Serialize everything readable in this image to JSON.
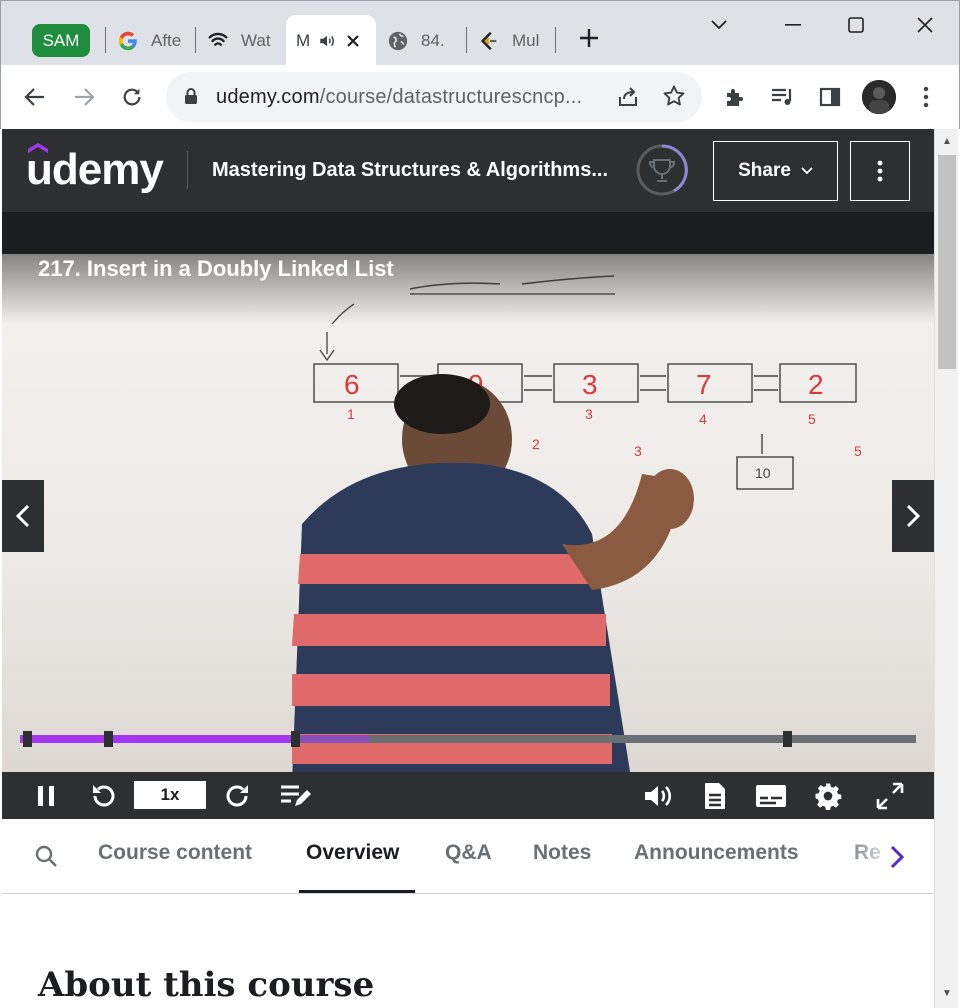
{
  "browser": {
    "profile_label": "SAM",
    "tabs": [
      {
        "label": "Afte",
        "icon": "google-icon"
      },
      {
        "label": "Wat",
        "icon": "wave-icon"
      },
      {
        "label": "M",
        "icon": "audio-icon",
        "active": true
      },
      {
        "label": "84.",
        "icon": "globe-icon"
      },
      {
        "label": "Mul",
        "icon": "bracket-icon"
      }
    ],
    "url_domain": "udemy.com",
    "url_path": "/course/datastructurescncp..."
  },
  "udemy": {
    "logo_text": "udemy",
    "course_title": "Mastering Data Structures & Algorithms...",
    "share_label": "Share",
    "lecture_title": "217. Insert in a Doubly Linked List",
    "speed_label": "1x",
    "playback_progress": 0.39,
    "buffered_progress": 0.39,
    "played_progress": 0.3
  },
  "page_tabs": [
    {
      "label": "Course content"
    },
    {
      "label": "Overview",
      "active": true
    },
    {
      "label": "Q&A"
    },
    {
      "label": "Notes"
    },
    {
      "label": "Announcements"
    },
    {
      "label": "Re"
    }
  ],
  "about_heading": "About this course",
  "colors": {
    "accent": "#a435f0",
    "header_bg": "#2d2f31",
    "profile_chip": "#1e8e3e"
  }
}
